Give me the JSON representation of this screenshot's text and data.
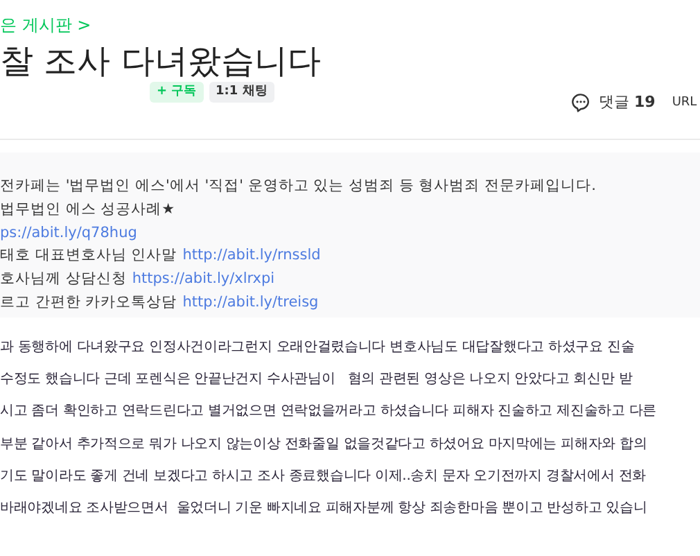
{
  "breadcrumb": "은 게시판 >",
  "title": "찰 조사 다녀왔습니다",
  "author_buttons": [
    {
      "kind": "subscribe",
      "icon": "+",
      "label": "구독"
    },
    {
      "kind": "chat",
      "label": "1:1 채팅"
    }
  ],
  "comments": {
    "label": "댓글",
    "count": "19"
  },
  "url_label": "URL",
  "notice": [
    {
      "text": "전카페는 '법무법인 에스'에서 '직접' 운영하고 있는 성범죄 등 형사범죄 전문카페입니다."
    },
    {
      "text": "법무법인 에스 성공사례★"
    },
    {
      "link": "ps://abit.ly/q78hug"
    },
    {
      "text": "태호 대표변호사님 인사말",
      "link": "http://abit.ly/rnssld"
    },
    {
      "text": "호사님께 상담신청",
      "link": "https://abit.ly/xlrxpi"
    },
    {
      "text": "르고 간편한 카카오톡상담",
      "link": "http://abit.ly/treisg"
    }
  ],
  "body": [
    "과 동행하에 다녀왔구요 인정사건이라그런지 오래안걸렸습니다 변호사님도 대답잘했다고 하셨구요 진술",
    "수정도 했습니다 근데 포렌식은 안끝난건지 수사관님이   혐의 관련된 영상은 나오지 안았다고 회신만 받",
    "시고 좀더 확인하고 연락드린다고 별거없으면 연락없을꺼라고 하셨습니다 피해자 진술하고 제진술하고 다른",
    "부분 같아서 추가적으로 뭐가 나오지 않는이상 전화줄일 없을것같다고 하셨어요 마지막에는 피해자와 합의",
    "기도 말이라도 좋게 건네 보겠다고 하시고 조사 종료했습니다 이제..송치 문자 오기전까지 경찰서에서 전화",
    "바래야겠네요 조사받으면서  울었더니 기운 빠지네요 피해자분께 항상 죄송한마음 뿐이고 반성하고 있습니"
  ]
}
